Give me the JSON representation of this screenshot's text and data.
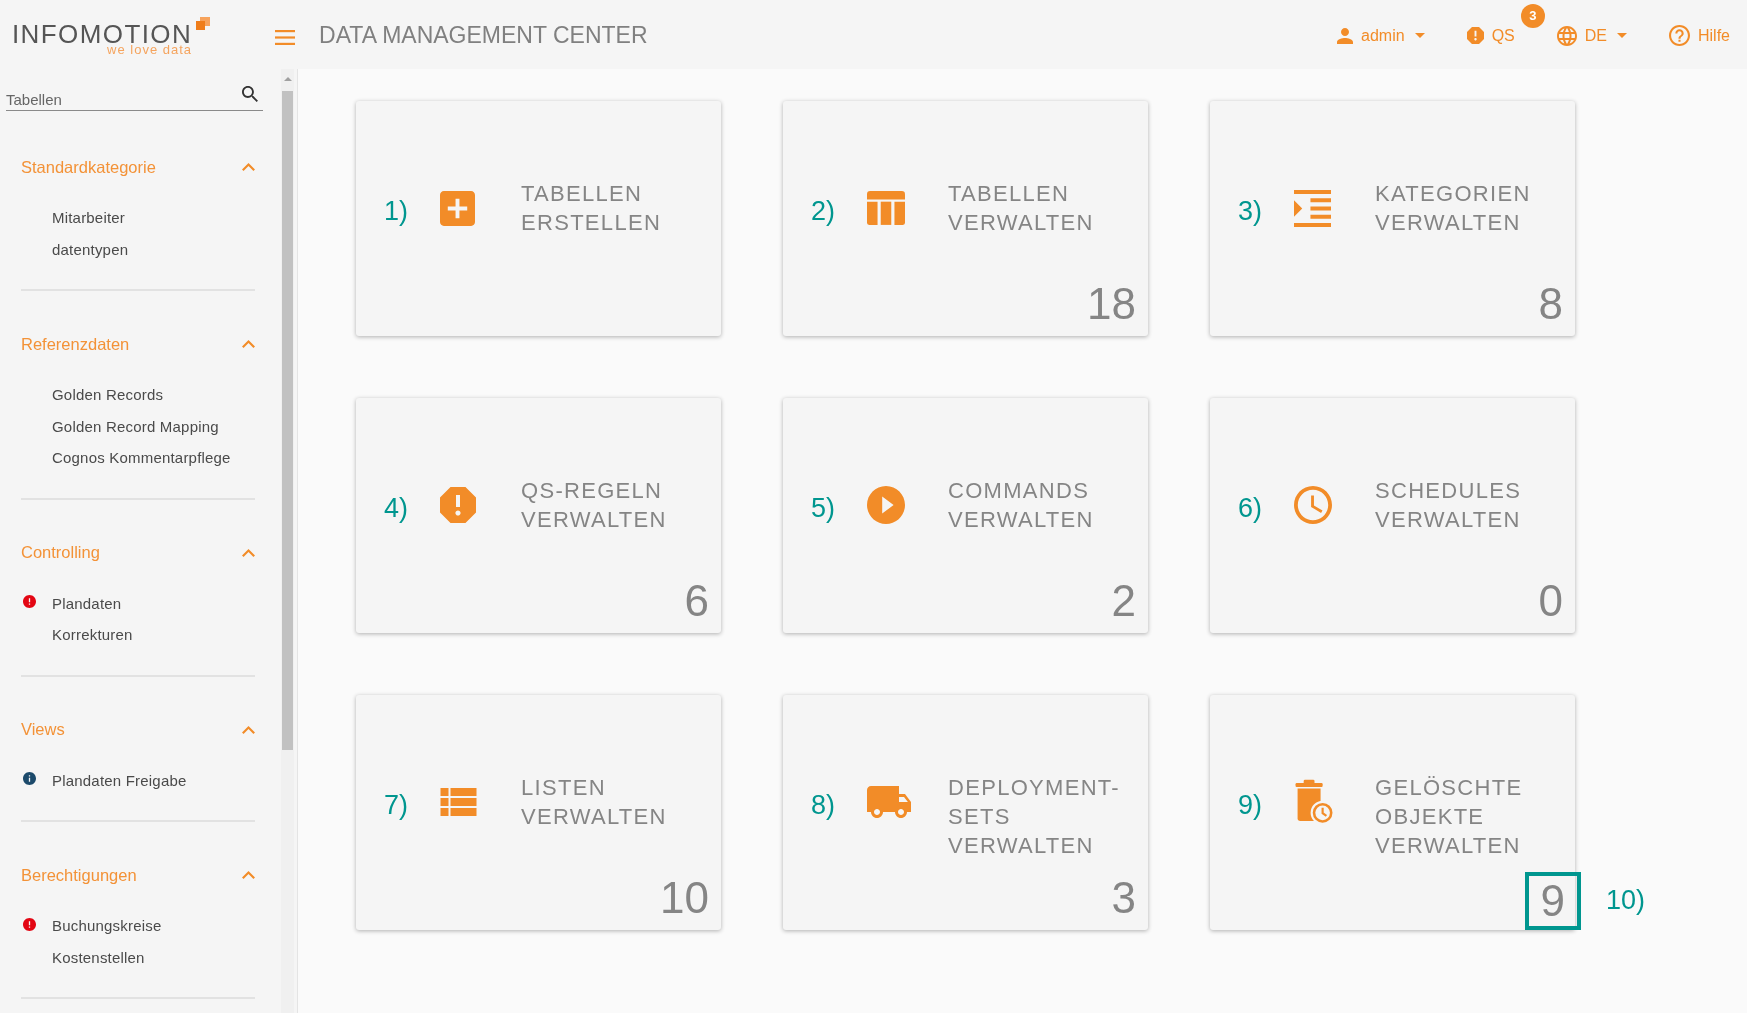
{
  "header": {
    "logo": {
      "name": "INFOMOTION",
      "tagline": "we love data"
    },
    "title": "DATA MANAGEMENT CENTER",
    "actions": [
      {
        "kind": "user",
        "label": "admin",
        "dropdown": true
      },
      {
        "kind": "alerts",
        "label": "QS",
        "badge": "3"
      },
      {
        "kind": "language",
        "label": "DE",
        "dropdown": true
      },
      {
        "kind": "help",
        "label": "Hilfe"
      }
    ]
  },
  "sidebar": {
    "search": {
      "placeholder": "Tabellen"
    },
    "sections": [
      {
        "title": "Standardkategorie",
        "expanded": true,
        "items": [
          {
            "kind": "plain",
            "label": "Mitarbeiter"
          },
          {
            "kind": "plain",
            "label": "datentypen"
          }
        ]
      },
      {
        "title": "Referenzdaten",
        "expanded": true,
        "items": [
          {
            "kind": "plain",
            "label": "Golden Records"
          },
          {
            "kind": "plain",
            "label": "Golden Record Mapping"
          },
          {
            "kind": "plain",
            "label": "Cognos Kommentarpflege"
          }
        ]
      },
      {
        "title": "Controlling",
        "expanded": true,
        "items": [
          {
            "kind": "error",
            "label": "Plandaten"
          },
          {
            "kind": "plain",
            "label": "Korrekturen"
          }
        ]
      },
      {
        "title": "Views",
        "expanded": true,
        "items": [
          {
            "kind": "info",
            "label": "Plandaten Freigabe"
          }
        ]
      },
      {
        "title": "Berechtigungen",
        "expanded": true,
        "items": [
          {
            "kind": "error",
            "label": "Buchungskreise"
          },
          {
            "kind": "plain",
            "label": "Kostenstellen"
          }
        ]
      }
    ]
  },
  "tiles": [
    {
      "kind": "create",
      "marker": "1)",
      "title": "TABELLEN ERSTELLEN"
    },
    {
      "kind": "tables",
      "marker": "2)",
      "title": "TABELLEN VERWALTEN",
      "count": "18"
    },
    {
      "kind": "categories",
      "marker": "3)",
      "title": "KATEGORIEN VERWALTEN",
      "count": "8"
    },
    {
      "kind": "rules",
      "marker": "4)",
      "title": "QS-REGELN VERWALTEN",
      "count": "6"
    },
    {
      "kind": "commands",
      "marker": "5)",
      "title": "COMMANDS VERWALTEN",
      "count": "2"
    },
    {
      "kind": "schedules",
      "marker": "6)",
      "title": "SCHEDULES VERWALTEN",
      "count": "0"
    },
    {
      "kind": "lists",
      "marker": "7)",
      "title": "LISTEN VERWALTEN",
      "count": "10"
    },
    {
      "kind": "deployment",
      "marker": "8)",
      "title": "DEPLOYMENT-SETS VERWALTEN",
      "count": "3"
    },
    {
      "kind": "deleted",
      "marker": "9)",
      "title": "GELÖSCHTE OBJEKTE VERWALTEN",
      "count": "9",
      "count_highlighted": true,
      "count_marker": "10)"
    }
  ]
}
